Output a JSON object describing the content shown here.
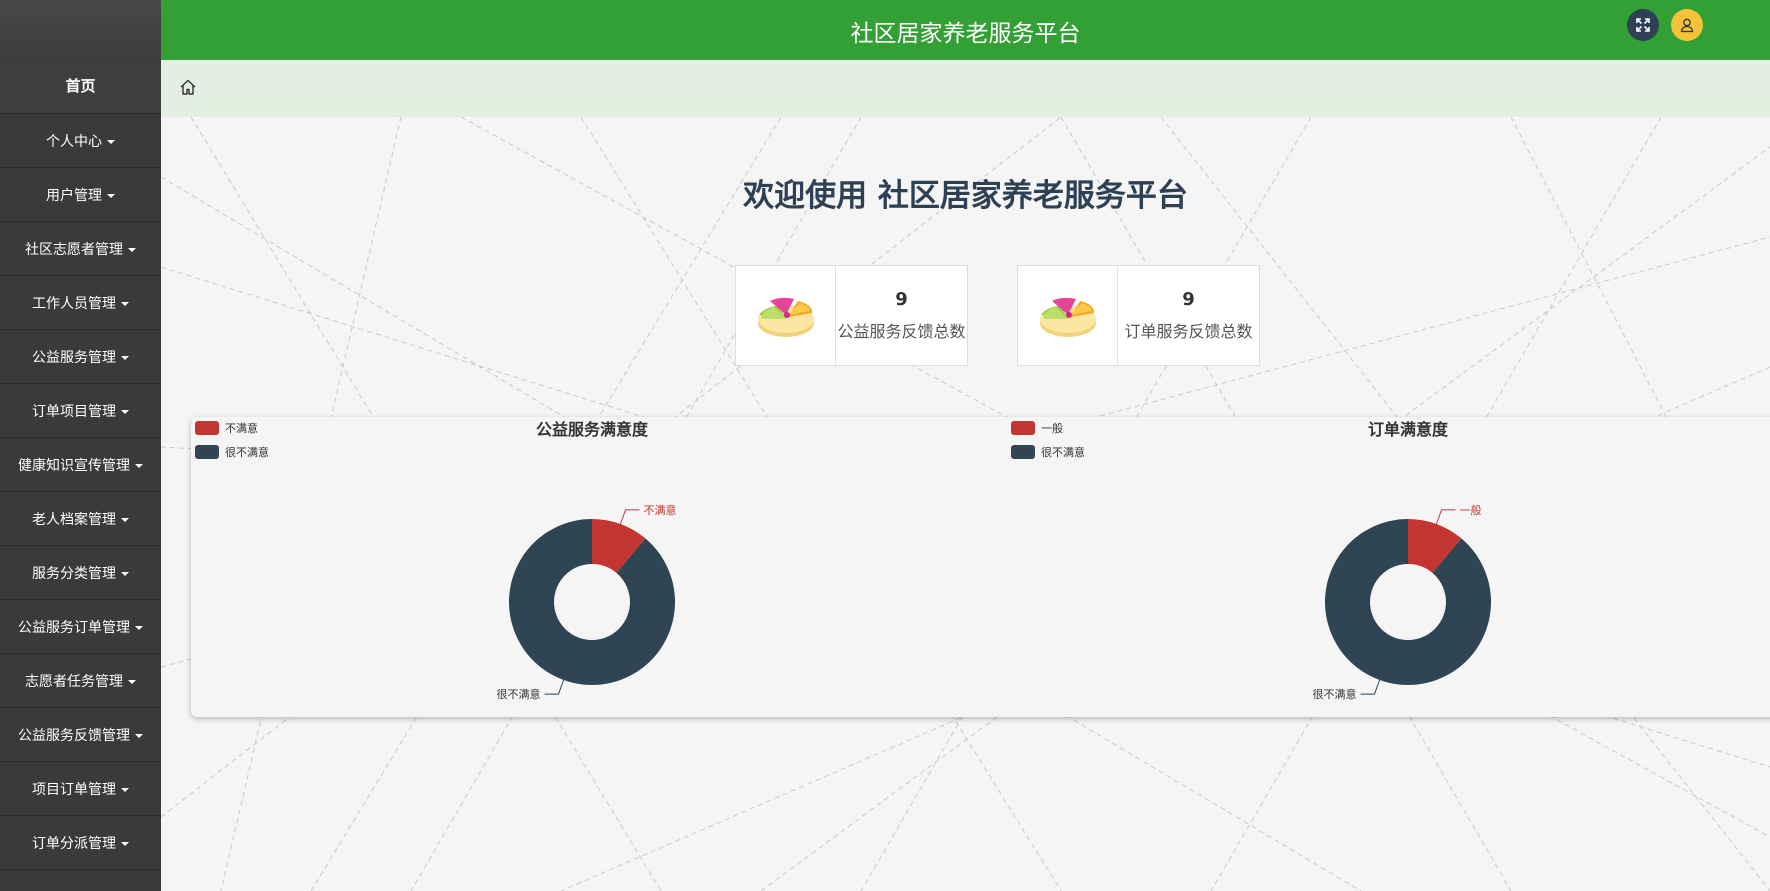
{
  "header": {
    "title": "社区居家养老服务平台"
  },
  "sidebar": {
    "items": [
      {
        "label": "首页",
        "caret": false
      },
      {
        "label": "个人中心",
        "caret": true
      },
      {
        "label": "用户管理",
        "caret": true
      },
      {
        "label": "社区志愿者管理",
        "caret": true
      },
      {
        "label": "工作人员管理",
        "caret": true
      },
      {
        "label": "公益服务管理",
        "caret": true
      },
      {
        "label": "订单项目管理",
        "caret": true
      },
      {
        "label": "健康知识宣传管理",
        "caret": true
      },
      {
        "label": "老人档案管理",
        "caret": true
      },
      {
        "label": "服务分类管理",
        "caret": true
      },
      {
        "label": "公益服务订单管理",
        "caret": true
      },
      {
        "label": "志愿者任务管理",
        "caret": true
      },
      {
        "label": "公益服务反馈管理",
        "caret": true
      },
      {
        "label": "项目订单管理",
        "caret": true
      },
      {
        "label": "订单分派管理",
        "caret": true
      }
    ]
  },
  "main": {
    "welcome": "欢迎使用 社区居家养老服务平台",
    "stats": [
      {
        "value": "9",
        "label": "公益服务反馈总数"
      },
      {
        "value": "9",
        "label": "订单服务反馈总数"
      }
    ]
  },
  "colors": {
    "header": "#33a036",
    "sidebar": "#3a3a3a",
    "accent_red": "#c23531",
    "accent_dark": "#2f4554"
  },
  "chart_data": [
    {
      "type": "pie",
      "title": "公益服务满意度",
      "legend": [
        "不满意",
        "很不满意"
      ],
      "series": [
        {
          "name": "不满意",
          "value": 1,
          "color": "#c23531"
        },
        {
          "name": "很不满意",
          "value": 8,
          "color": "#2f4554"
        }
      ]
    },
    {
      "type": "pie",
      "title": "订单满意度",
      "legend": [
        "一般",
        "很不满意"
      ],
      "series": [
        {
          "name": "一般",
          "value": 1,
          "color": "#c23531"
        },
        {
          "name": "很不满意",
          "value": 8,
          "color": "#2f4554"
        }
      ]
    }
  ]
}
